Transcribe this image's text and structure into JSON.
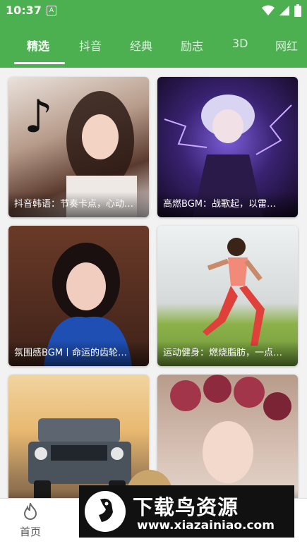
{
  "status_bar": {
    "time": "10:37",
    "notification_icon": "A"
  },
  "tabs": [
    {
      "label": "精选",
      "active": true
    },
    {
      "label": "抖音"
    },
    {
      "label": "经典"
    },
    {
      "label": "励志"
    },
    {
      "label": "3D"
    },
    {
      "label": "网红"
    }
  ],
  "cards": [
    {
      "caption": "抖音韩语：节奏卡点，心动…",
      "thumb": "girl-portrait-tiktok"
    },
    {
      "caption": "高燃BGM：战歌起，以雷…",
      "thumb": "anime-character"
    },
    {
      "caption": "氛围感BGM丨命运的齿轮…",
      "thumb": "girl-blue-scarf"
    },
    {
      "caption": "运动健身：燃烧脂肪，一点…",
      "thumb": "sprinter"
    },
    {
      "caption": "",
      "thumb": "offroad-car"
    },
    {
      "caption": "",
      "thumb": "girl-flower-crown"
    }
  ],
  "bottom_nav": {
    "home_label": "首页",
    "home_icon": "flame-icon"
  },
  "watermark": {
    "title": "下载鸟资源",
    "url": "www.xiazainiao.com"
  },
  "colors": {
    "primary": "#4caf50",
    "nav_bg": "#ffffff"
  }
}
